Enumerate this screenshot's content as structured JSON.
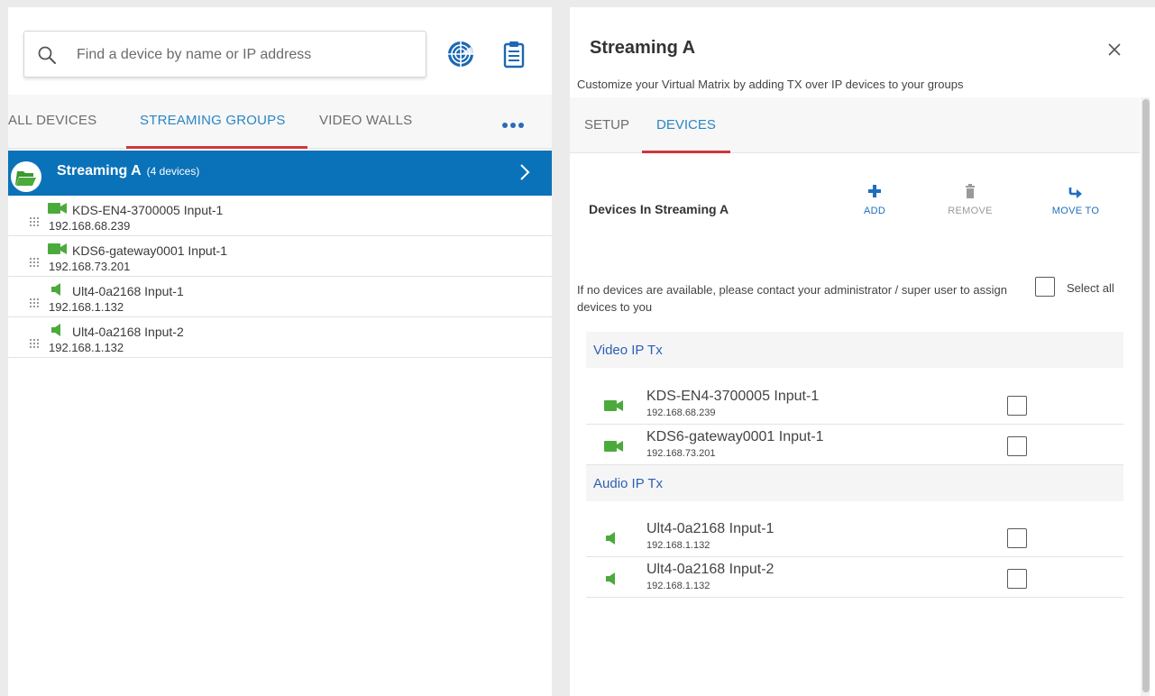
{
  "colors": {
    "accent": "#2b86c5",
    "brand_blue": "#0a72b9",
    "tab_underline": "#d0363b",
    "device_icon": "#4caa3c"
  },
  "left": {
    "search": {
      "placeholder": "Find a device by name or IP address",
      "value": ""
    },
    "icons": {
      "search": "search-icon",
      "radar": "radar-icon",
      "clipboard": "clipboard-icon",
      "more": "more-icon"
    },
    "tabs": [
      {
        "label": "ALL DEVICES",
        "active": false
      },
      {
        "label": "STREAMING GROUPS",
        "active": true
      },
      {
        "label": "VIDEO WALLS",
        "active": false
      }
    ],
    "group": {
      "name": "Streaming A",
      "count": "(4 devices)"
    },
    "devices": [
      {
        "name": "KDS-EN4-3700005 Input-1",
        "ip": "192.168.68.239",
        "icon": "video-camera-icon"
      },
      {
        "name": "KDS6-gateway0001 Input-1",
        "ip": "192.168.73.201",
        "icon": "video-camera-icon"
      },
      {
        "name": "Ult4-0a2168 Input-1",
        "ip": "192.168.1.132",
        "icon": "speaker-icon"
      },
      {
        "name": "Ult4-0a2168 Input-2",
        "ip": "192.168.1.132",
        "icon": "speaker-icon"
      }
    ]
  },
  "right": {
    "title": "Streaming A",
    "subtitle": "Customize your Virtual Matrix by adding TX over IP devices to your groups",
    "tabs": [
      {
        "label": "SETUP",
        "active": false
      },
      {
        "label": "DEVICES",
        "active": true
      }
    ],
    "devices_heading": "Devices In Streaming A",
    "actions": {
      "add": "ADD",
      "remove": "REMOVE",
      "move": "MOVE TO"
    },
    "notice": "If no devices are available, please contact your administrator / super user to assign devices to you",
    "select_all": "Select all",
    "sections": [
      {
        "title": "Video IP Tx",
        "devices": [
          {
            "name": "KDS-EN4-3700005 Input-1",
            "ip": "192.168.68.239",
            "icon": "video-camera-icon",
            "checked": false
          },
          {
            "name": "KDS6-gateway0001 Input-1",
            "ip": "192.168.73.201",
            "icon": "video-camera-icon",
            "checked": false
          }
        ]
      },
      {
        "title": "Audio IP Tx",
        "devices": [
          {
            "name": "Ult4-0a2168 Input-1",
            "ip": "192.168.1.132",
            "icon": "speaker-icon",
            "checked": false
          },
          {
            "name": "Ult4-0a2168 Input-2",
            "ip": "192.168.1.132",
            "icon": "speaker-icon",
            "checked": false
          }
        ]
      }
    ]
  }
}
